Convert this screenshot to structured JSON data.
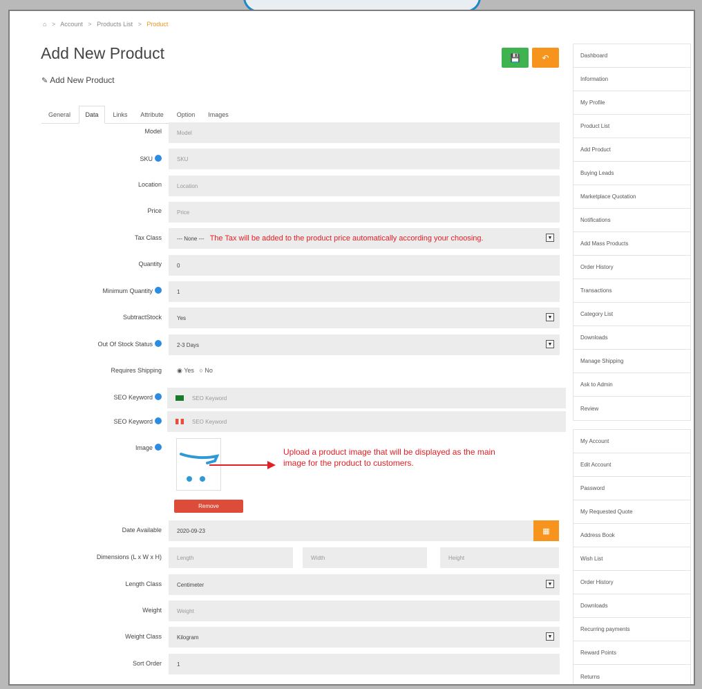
{
  "breadcrumb": {
    "home_icon": "home-icon",
    "sep": ">",
    "items": [
      "Account",
      "Products List",
      "Product"
    ]
  },
  "header": {
    "title": "Add New Product",
    "subtitle": "Add New Product",
    "save_icon": "save-icon",
    "back_icon": "reply-icon"
  },
  "tabs": [
    "General",
    "Data",
    "Links",
    "Attribute",
    "Option",
    "Images"
  ],
  "active_tab": "Data",
  "form": {
    "model": {
      "label": "Model",
      "placeholder": "Model"
    },
    "sku": {
      "label": "SKU",
      "placeholder": "SKU"
    },
    "location": {
      "label": "Location",
      "placeholder": "Location"
    },
    "price": {
      "label": "Price",
      "placeholder": "Price"
    },
    "tax_class": {
      "label": "Tax Class",
      "value": "--- None ---",
      "note": "The Tax will be added to the product price automatically according your choosing."
    },
    "quantity": {
      "label": "Quantity",
      "value": "0"
    },
    "minimum_quantity": {
      "label": "Minimum Quantity",
      "value": "1"
    },
    "subtract_stock": {
      "label": "SubtractStock",
      "value": "Yes"
    },
    "out_of_stock_status": {
      "label": "Out Of Stock Status",
      "value": "2-3 Days"
    },
    "requires_shipping": {
      "label": "Requires Shipping",
      "yes": "Yes",
      "no": "No",
      "selected": "Yes"
    },
    "seo_keyword_1": {
      "label": "SEO Keyword",
      "placeholder": "SEO Keyword"
    },
    "seo_keyword_2": {
      "label": "SEO Keyword",
      "placeholder": "SEO Keyword"
    },
    "image": {
      "label": "Image",
      "remove_label": "Remove"
    },
    "date_available": {
      "label": "Date Available",
      "value": "2020-09-23"
    },
    "dimensions": {
      "label": "Dimensions (L x W x H)",
      "length_placeholder": "Length",
      "width_placeholder": "Width",
      "height_placeholder": "Height"
    },
    "length_class": {
      "label": "Length Class",
      "value": "Centimeter"
    },
    "weight": {
      "label": "Weight",
      "placeholder": "Weight"
    },
    "weight_class": {
      "label": "Weight Class",
      "value": "Kilogram"
    },
    "sort_order": {
      "label": "Sort Order",
      "value": "1"
    }
  },
  "annotation": {
    "image_note": "Upload a product image that will be displayed as the main image for the product to customers."
  },
  "sidebar_top": [
    "Dashboard",
    "Information",
    "My Profile",
    "Product List",
    "Add Product",
    "Buying Leads",
    "Marketplace Quotation",
    "Notifications",
    "Add Mass Products",
    "Order History",
    "Transactions",
    "Category List",
    "Downloads",
    "Manage Shipping",
    "Ask to Admin",
    "Review"
  ],
  "sidebar_bottom": [
    "My Account",
    "Edit Account",
    "Password",
    "My Requested Quote",
    "Address Book",
    "Wish List",
    "Order History",
    "Downloads",
    "Recurring payments",
    "Reward Points",
    "Returns"
  ],
  "colors": {
    "green": "#3fb34f",
    "orange": "#f7941d",
    "red": "#dd4b39",
    "note": "#e31e24",
    "info": "#2d8ce0"
  }
}
